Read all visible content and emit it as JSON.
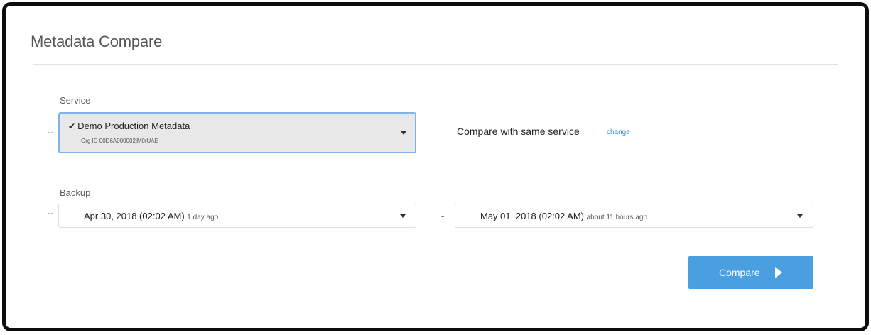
{
  "page": {
    "title": "Metadata Compare"
  },
  "service": {
    "label": "Service",
    "selected_name": "Demo Production Metadata",
    "org_id": "Org ID 00D6A000002jM0rUAE",
    "separator": "-",
    "compare_text": "Compare with same service",
    "change_label": "change"
  },
  "backup": {
    "label": "Backup",
    "separator": "-",
    "left": {
      "date": "Apr 30, 2018 (02:02 AM)",
      "ago": "1 day ago"
    },
    "right": {
      "date": "May 01, 2018 (02:02 AM)",
      "ago": "about 11 hours ago"
    }
  },
  "actions": {
    "compare_label": "Compare"
  },
  "colors": {
    "accent": "#4a9fe0",
    "link": "#3a8fd9",
    "focus_border": "#7fb4e8",
    "selected_bg": "#e8e8e8"
  },
  "icons": [
    "checkmark-icon",
    "chevron-down-icon",
    "play-icon"
  ]
}
